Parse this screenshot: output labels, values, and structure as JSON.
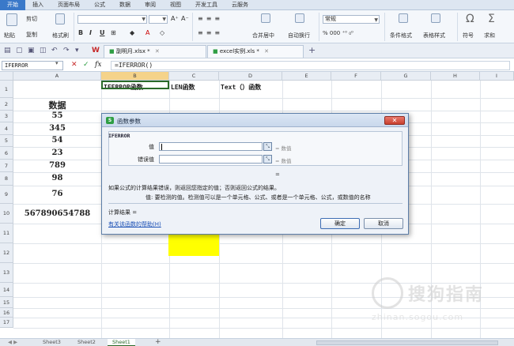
{
  "ribbon_tabs": [
    "开始",
    "插入",
    "页面布局",
    "公式",
    "数据",
    "审阅",
    "视图",
    "开发工具",
    "云服务"
  ],
  "ribbon": {
    "clipboard": {
      "cut": "剪切",
      "paste": "粘贴",
      "copy": "复制",
      "format_painter": "格式刷"
    },
    "font_size_grow": "A⁺",
    "font_size_shrink": "A⁻",
    "bold": "B",
    "italic": "I",
    "underline": "U",
    "merge_center": "合并居中",
    "wrap_text": "自动换行",
    "number_format": "常规",
    "number_buttons": "% 000 ⁺⁰ ₀⁰",
    "conditional_format": "条件格式",
    "table_style": "表格样式",
    "symbol": "符号",
    "sum": "求和"
  },
  "doc_tabs": [
    {
      "label": "副明月.xlsx *",
      "color": "#2f9e44"
    },
    {
      "label": "excel实例.xls *",
      "color": "#2f9e44"
    }
  ],
  "formula_bar": {
    "name_box": "IFERROR",
    "formula": "=IFERROR()",
    "fx": "fx"
  },
  "columns": [
    "A",
    "B",
    "C",
    "D",
    "E",
    "F",
    "G",
    "H",
    "I"
  ],
  "rows": [
    "1",
    "2",
    "3",
    "4",
    "5",
    "6",
    "7",
    "8",
    "9",
    "10",
    "11",
    "12",
    "13",
    "14",
    "15",
    "16",
    "17"
  ],
  "cells": {
    "b1": "IFERROR函数",
    "c1": "LEN函数",
    "d1": "Text（）函数",
    "a2": "数据",
    "a3": "55",
    "a4": "345",
    "a5": "54",
    "a6": "23",
    "a7": "789",
    "a8": "98",
    "a9": "76",
    "a10": "567890654788"
  },
  "sheet_tabs": [
    "Sheet3",
    "Sheet2",
    "Sheet1"
  ],
  "dialog": {
    "title": "函数参数",
    "function_name": "IFERROR",
    "arg1_label": "值",
    "arg2_label": "错误值",
    "arg1_value": "= 数值",
    "arg2_value": "= 数值",
    "equals": "=",
    "description": "如果公式的计算结果错误，则返回您指定的值；否则返回公式的结果。",
    "arg_help": "值:   要检测的值。检测值可以是一个单元格、公式、或者是一个单元格、公式，或数值的名称",
    "result": "计算结果 =",
    "help_link": "有关该函数的帮助(H)",
    "ok": "确定",
    "cancel": "取消"
  },
  "watermark": {
    "brand": "搜狗指南",
    "url": "zhinan.sogou.com"
  }
}
